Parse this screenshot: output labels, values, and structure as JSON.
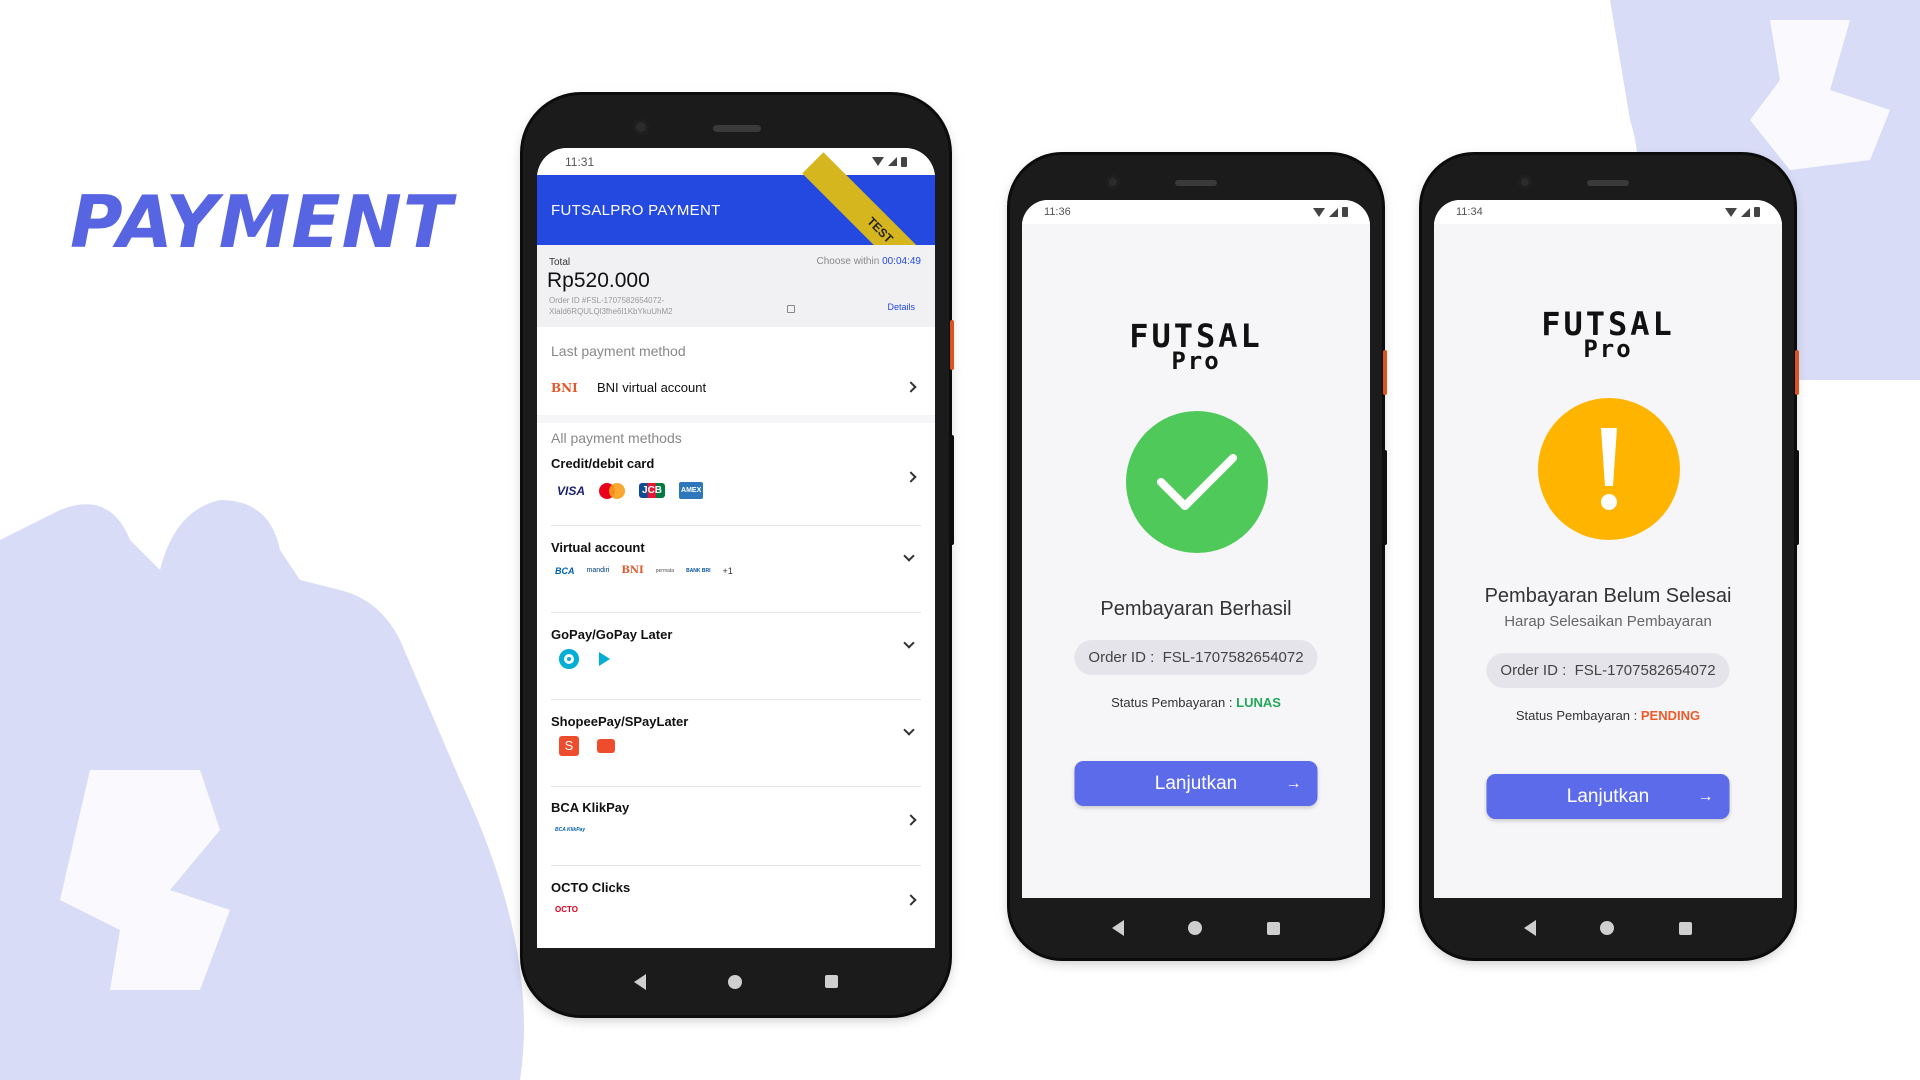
{
  "headline": "PAYMENT",
  "colors": {
    "accent": "#5865e3",
    "header_blue": "#2349e1",
    "success": "#4fc95a",
    "warning": "#ffb400",
    "lunas": "#22a85a",
    "pending": "#ef5a28",
    "bg_shape": "#d9dcf7"
  },
  "phone1": {
    "time": "11:31",
    "header_title": "FUTSALPRO PAYMENT",
    "ribbon": "TEST",
    "total_label": "Total",
    "total_amount": "Rp520.000",
    "choose_within": "Choose within",
    "timer": "00:04:49",
    "order_id": "Order ID #FSL-1707582654072-Xlald6RQULQl3fhe6l1KbYkuUhM2",
    "details": "Details",
    "last_method_title": "Last payment method",
    "last_method_name": "BNI virtual account",
    "last_method_logo": "BNI",
    "all_methods_title": "All payment methods",
    "methods": [
      {
        "name": "Credit/debit card",
        "logos": [
          "VISA",
          "mastercard",
          "JCB",
          "AMEX"
        ]
      },
      {
        "name": "Virtual account",
        "logos": [
          "BCA",
          "mandiri",
          "BNI",
          "permata",
          "BANK BRI",
          "+1"
        ]
      },
      {
        "name": "GoPay/GoPay Later",
        "logos": [
          "gopay-icon",
          "gopaylater-icon"
        ]
      },
      {
        "name": "ShopeePay/SPayLater",
        "logos": [
          "shopeepay-icon",
          "spaylater-icon"
        ]
      },
      {
        "name": "BCA KlikPay",
        "logos": [
          "BCA KlikPay"
        ]
      },
      {
        "name": "OCTO Clicks",
        "logos": [
          "OCTO"
        ]
      }
    ]
  },
  "phone2": {
    "time": "11:36",
    "brand_line1": "FUTSAL",
    "brand_line2": "Pro",
    "status_icon": "check-icon",
    "title": "Pembayaran Berhasil",
    "order_label": "Order ID :",
    "order_id": "FSL-1707582654072",
    "status_label": "Status Pembayaran :",
    "status_value": "LUNAS",
    "button": "Lanjutkan"
  },
  "phone3": {
    "time": "11:34",
    "brand_line1": "FUTSAL",
    "brand_line2": "Pro",
    "status_icon": "exclamation-icon",
    "title": "Pembayaran Belum Selesai",
    "subtitle": "Harap Selesaikan Pembayaran",
    "order_label": "Order ID :",
    "order_id": "FSL-1707582654072",
    "status_label": "Status Pembayaran :",
    "status_value": "PENDING",
    "button": "Lanjutkan"
  }
}
